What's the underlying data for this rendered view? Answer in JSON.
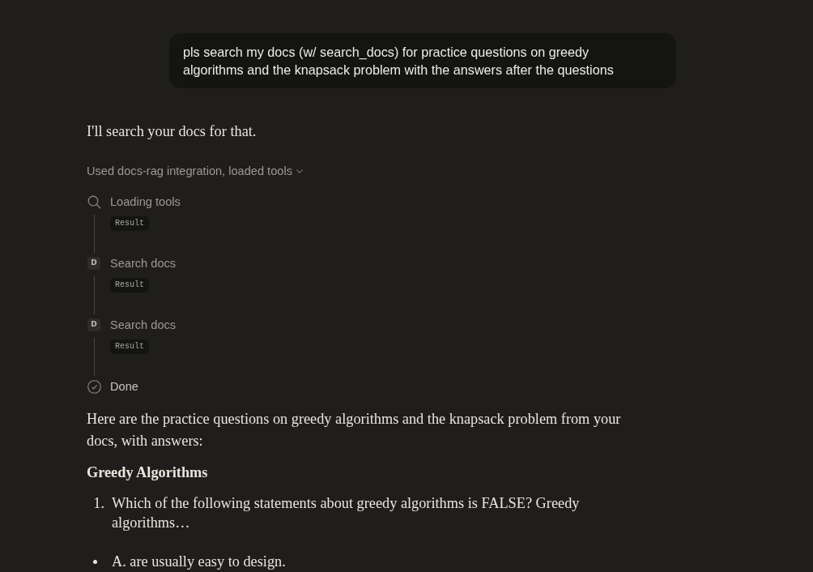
{
  "user_message": {
    "text": "pls search my docs (w/ search_docs) for practice questions on greedy algorithms and the knapsack problem with the answers after the questions"
  },
  "assistant": {
    "intro": "I'll search your docs for that.",
    "tool_summary": {
      "label": "Used docs-rag integration, loaded tools"
    },
    "steps": [
      {
        "kind": "search",
        "title": "Loading tools",
        "result": "Result"
      },
      {
        "kind": "source",
        "icon_letter": "D",
        "title": "Search docs",
        "result": "Result"
      },
      {
        "kind": "source",
        "icon_letter": "D",
        "title": "Search docs",
        "result": "Result"
      },
      {
        "kind": "done",
        "title": "Done"
      }
    ],
    "response": {
      "paragraph": "Here are the practice questions on greedy algorithms and the knapsack problem from your docs, with answers:",
      "heading": "Greedy Algorithms",
      "questions": [
        {
          "number": "1.",
          "text": "Which of the following statements about greedy algorithms is FALSE? Greedy algorithms…"
        }
      ],
      "options": [
        "A. are usually easy to design."
      ]
    }
  }
}
